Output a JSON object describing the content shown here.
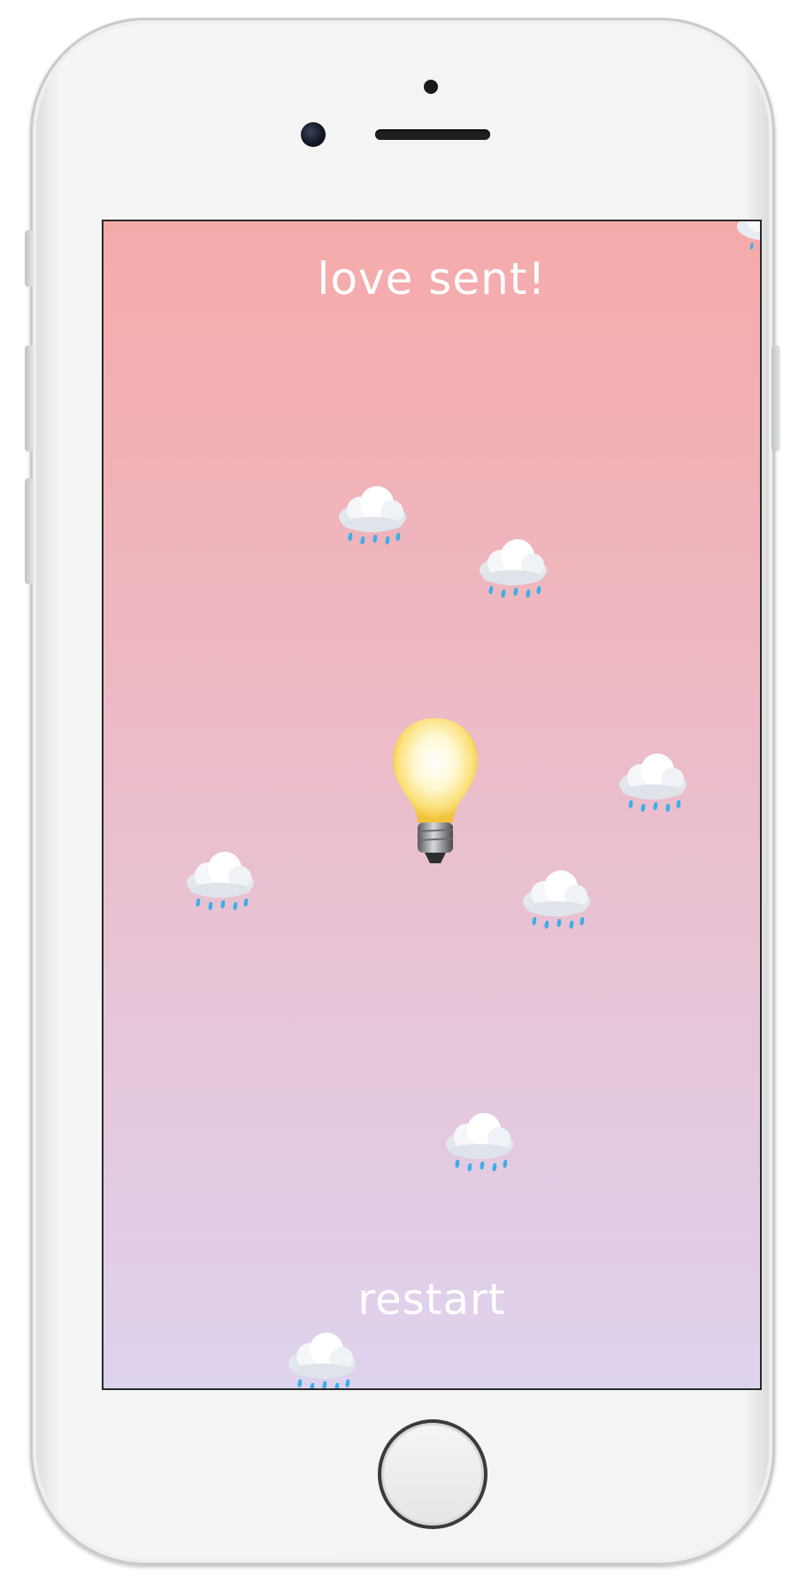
{
  "app": {
    "message": "love sent!",
    "restart_label": "restart"
  },
  "center_icon": "light-bulb-icon",
  "falling_icon": "cloud-with-rain-icon",
  "colors": {
    "gradient_top": "#f5aaaa",
    "gradient_bottom": "#ded3ee",
    "text": "#ffffff",
    "device_body": "#f3f4f4"
  }
}
